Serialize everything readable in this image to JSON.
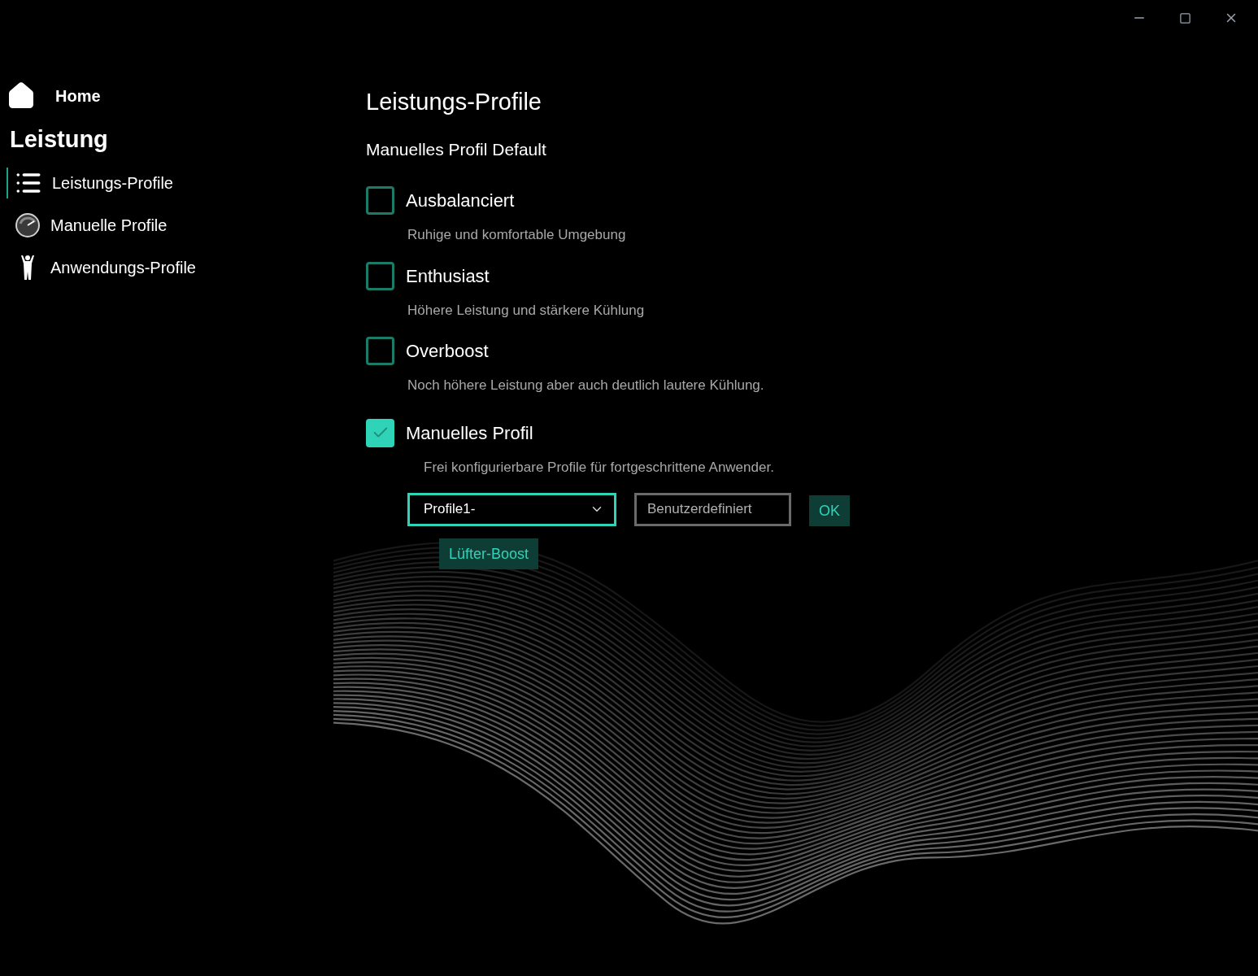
{
  "sidebar": {
    "home": "Home",
    "section": "Leistung",
    "items": [
      {
        "label": "Leistungs-Profile",
        "selected": true
      },
      {
        "label": "Manuelle Profile",
        "selected": false
      },
      {
        "label": "Anwendungs-Profile",
        "selected": false
      }
    ]
  },
  "page_title": "Leistungs-Profile",
  "subtitle": "Manuelles Profil Default",
  "options": [
    {
      "label": "Ausbalanciert",
      "description": "Ruhige und komfortable Umgebung",
      "checked": false
    },
    {
      "label": "Enthusiast",
      "description": "Höhere Leistung und stärkere Kühlung",
      "checked": false
    },
    {
      "label": "Overboost",
      "description": "Noch höhere Leistung aber auch deutlich lautere Kühlung.",
      "checked": false
    },
    {
      "label": "Manuelles Profil",
      "description": "Frei konfigurierbare Profile für fortgeschrittene Anwender.",
      "checked": true
    }
  ],
  "profile_select": {
    "value": "Profile1-"
  },
  "name_field": {
    "placeholder": "Benutzerdefiniert"
  },
  "ok_button": "OK",
  "fan_boost_button": "Lüfter-Boost"
}
